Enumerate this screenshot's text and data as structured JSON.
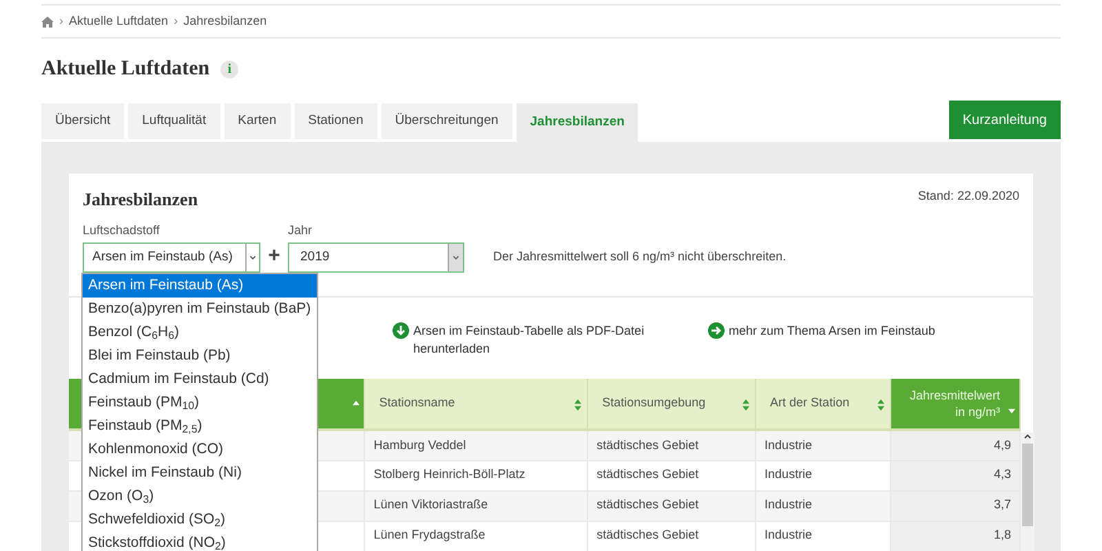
{
  "breadcrumb": [
    {
      "kind": "separator",
      "text": "›"
    },
    {
      "kind": "link",
      "text": "Aktuelle Luftdaten"
    },
    {
      "kind": "separator",
      "text": "›"
    },
    {
      "kind": "link",
      "text": "Jahresbilanzen"
    }
  ],
  "page_title": "Aktuelle Luftdaten",
  "info_badge": "i",
  "tabs": [
    {
      "label": "Übersicht",
      "selected": false
    },
    {
      "label": "Luftqualität",
      "selected": false
    },
    {
      "label": "Karten",
      "selected": false
    },
    {
      "label": "Stationen",
      "selected": false
    },
    {
      "label": "Überschreitungen",
      "selected": false
    },
    {
      "label": "Jahresbilanzen",
      "selected": true
    }
  ],
  "guide_button": "Kurzanleitung",
  "card": {
    "title": "Jahresbilanzen",
    "date": "Stand: 22.09.2020",
    "pollutant": {
      "label": "Luftschadstoff",
      "value": "Arsen im Feinstaub (As)"
    },
    "add_symbol": "+",
    "year": {
      "label": "Jahr",
      "value": "2019"
    },
    "limit_note": "Der Jahresmittelwert soll 6 ng/m³ nicht überschreiten.",
    "links": [
      {
        "kind": "download",
        "text": "Arsen im Feinstaub-Tabelle als PDF-Datei herunterladen"
      },
      {
        "kind": "more",
        "text": "mehr zum Thema Arsen im Feinstaub"
      }
    ]
  },
  "dropdown": [
    {
      "label": "Arsen im Feinstaub (As)",
      "selected": true
    },
    {
      "label": "Benzo(a)pyren im Feinstaub (BaP)",
      "selected": false
    },
    {
      "label": "Benzol (C$_{6}$H$_{6}$)",
      "selected": false
    },
    {
      "label": "Blei im Feinstaub (Pb)",
      "selected": false
    },
    {
      "label": "Cadmium im Feinstaub (Cd)",
      "selected": false
    },
    {
      "label": "Feinstaub (PM$_{10}$)",
      "selected": false
    },
    {
      "label": "Feinstaub (PM$_{2,5}$)",
      "selected": false
    },
    {
      "label": "Kohlenmonoxid (CO)",
      "selected": false
    },
    {
      "label": "Nickel im Feinstaub (Ni)",
      "selected": false
    },
    {
      "label": "Ozon (O$_{3}$)",
      "selected": false
    },
    {
      "label": "Schwefeldioxid (SO$_{2}$)",
      "selected": false
    },
    {
      "label": "Stickstoffdioxid (NO$_{2}$)",
      "selected": false
    }
  ],
  "table": {
    "columns": [
      {
        "kind": "sorted-asc"
      },
      {
        "label": "Stationsname",
        "kind": "sortable"
      },
      {
        "label": "Stationsumgebung",
        "kind": "sortable"
      },
      {
        "label": "Art der Station",
        "kind": "sortable"
      },
      {
        "label": "Jahresmittelwert in ng/m³",
        "kind": "sorted-desc"
      }
    ],
    "rows": [
      [
        "",
        "Hamburg Veddel",
        "städtisches Gebiet",
        "Industrie",
        "4,9"
      ],
      [
        "",
        "Stolberg Heinrich-Böll-Platz",
        "städtisches Gebiet",
        "Industrie",
        "4,3"
      ],
      [
        "",
        "Lünen Viktoriastraße",
        "städtisches Gebiet",
        "Industrie",
        "3,7"
      ],
      [
        "",
        "Lünen Frydagstraße",
        "städtisches Gebiet",
        "Industrie",
        "1,8"
      ]
    ]
  }
}
